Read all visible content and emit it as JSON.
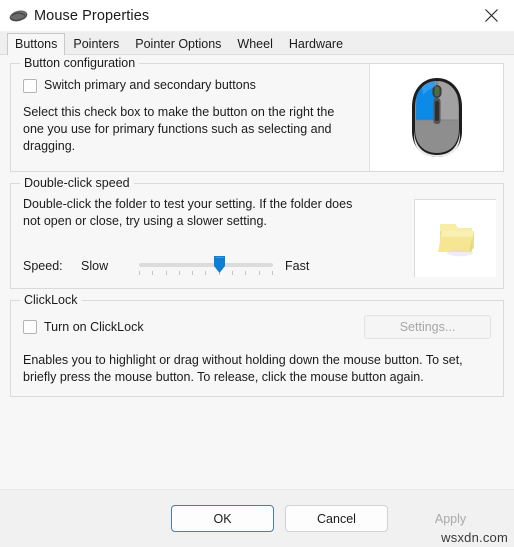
{
  "window": {
    "title": "Mouse Properties",
    "icon": "mouse-icon",
    "close_icon": "close-icon"
  },
  "tabs": [
    {
      "label": "Buttons",
      "active": true
    },
    {
      "label": "Pointers",
      "active": false
    },
    {
      "label": "Pointer Options",
      "active": false
    },
    {
      "label": "Wheel",
      "active": false
    },
    {
      "label": "Hardware",
      "active": false
    }
  ],
  "button_configuration": {
    "group_title": "Button configuration",
    "switch_checkbox": {
      "label": "Switch primary and secondary buttons",
      "checked": false
    },
    "description": "Select this check box to make the button on the right the one you use for primary functions such as selecting and dragging.",
    "preview_icon": "mouse-preview-image",
    "preview_colors": {
      "primary_button": "#0b8ae8",
      "secondary_button": "#9a9a9a",
      "body": "#8e8e8e",
      "outline": "#1c1c1c"
    }
  },
  "double_click_speed": {
    "group_title": "Double-click speed",
    "description": "Double-click the folder to test your setting. If the folder does not open or close, try using a slower setting.",
    "speed_label": "Speed:",
    "slow_label": "Slow",
    "fast_label": "Fast",
    "slider": {
      "value": 60,
      "min": 0,
      "max": 100,
      "tick_count": 11,
      "thumb_color": "#0f7fd4"
    },
    "folder_icon": "folder-icon",
    "folder_color": "#f5e27f"
  },
  "clicklock": {
    "group_title": "ClickLock",
    "turn_on_checkbox": {
      "label": "Turn on ClickLock",
      "checked": false
    },
    "settings_button": {
      "label": "Settings...",
      "enabled": false
    },
    "description": "Enables you to highlight or drag without holding down the mouse button. To set, briefly press the mouse button. To release, click the mouse button again."
  },
  "footer": {
    "ok_label": "OK",
    "cancel_label": "Cancel",
    "apply_label": "Apply",
    "apply_enabled": false,
    "default_button": "OK"
  },
  "watermark": "wsxdn.com"
}
